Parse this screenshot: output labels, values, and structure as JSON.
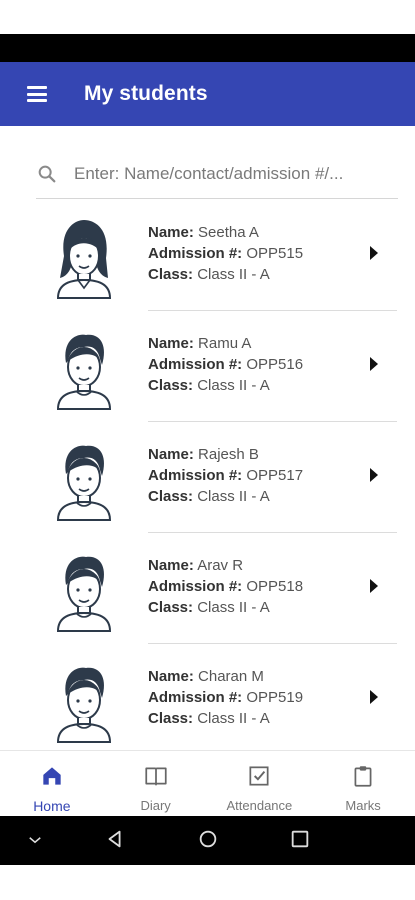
{
  "app_bar": {
    "title": "My students",
    "menu_icon": "hamburger-menu-icon"
  },
  "search": {
    "placeholder": "Enter: Name/contact/admission #/...",
    "icon": "search-icon"
  },
  "labels": {
    "name": "Name:",
    "admission": "Admission #:",
    "class": "Class:"
  },
  "students": [
    {
      "name": "Seetha A",
      "admission": "OPP515",
      "class": "Class II - A",
      "avatar": "girl-avatar-icon"
    },
    {
      "name": "Ramu A",
      "admission": "OPP516",
      "class": "Class II - A",
      "avatar": "boy-avatar-icon"
    },
    {
      "name": "Rajesh B",
      "admission": "OPP517",
      "class": "Class II - A",
      "avatar": "boy-avatar-icon"
    },
    {
      "name": "Arav R",
      "admission": "OPP518",
      "class": "Class II - A",
      "avatar": "boy-avatar-icon"
    },
    {
      "name": "Charan M",
      "admission": "OPP519",
      "class": "Class II - A",
      "avatar": "boy-avatar-icon"
    }
  ],
  "bottom_nav": [
    {
      "label": "Home",
      "icon": "home-icon",
      "active": true
    },
    {
      "label": "Diary",
      "icon": "book-icon",
      "active": false
    },
    {
      "label": "Attendance",
      "icon": "checkbox-icon",
      "active": false
    },
    {
      "label": "Marks",
      "icon": "clipboard-icon",
      "active": false
    }
  ],
  "colors": {
    "primary": "#3546b3",
    "text": "#555555",
    "divider": "#dcdcdc"
  }
}
